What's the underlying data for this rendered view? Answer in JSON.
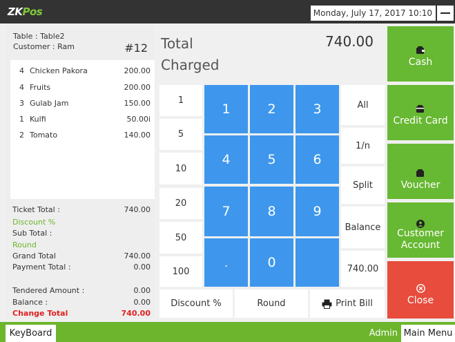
{
  "app": {
    "logo_main": "ZK",
    "logo_accent": "Pos",
    "datetime": "Monday, July 17, 2017 10:10"
  },
  "ticket": {
    "table": "Table : Table2",
    "customer": "Customer : Ram",
    "number": "#12",
    "items": [
      {
        "qty": "4",
        "name": "Chicken Pakora",
        "price": "200.00"
      },
      {
        "qty": "4",
        "name": "Fruits",
        "price": "200.00"
      },
      {
        "qty": "3",
        "name": "Gulab Jam",
        "price": "150.00"
      },
      {
        "qty": "1",
        "name": "Kulfi",
        "price": "50.00i"
      },
      {
        "qty": "2",
        "name": "Tomato",
        "price": "140.00"
      }
    ],
    "totals": {
      "ticket_total_label": "Ticket Total :",
      "ticket_total_value": "740.00",
      "discount_label": "Discount %",
      "sub_total_label": "Sub Total :",
      "round_label": "Round",
      "grand_total_label": "Grand Total",
      "grand_total_value": "740.00",
      "payment_total_label": "Payment Total :",
      "payment_total_value": "0.00",
      "tendered_label": "Tendered Amount :",
      "tendered_value": "0.00",
      "balance_label": "Balance :",
      "balance_value": "0.00",
      "change_label": "Change Total",
      "change_value": "740.00"
    }
  },
  "payment": {
    "total_title": "Total Charged",
    "total_amount": "740.00"
  },
  "keypad": {
    "quick_amounts": [
      "1",
      "5",
      "10",
      "20",
      "50",
      "100"
    ],
    "digits": [
      "1",
      "2",
      "3",
      "4",
      "5",
      "6",
      "7",
      "8",
      "9",
      ".",
      "0"
    ],
    "right_keys": [
      "All",
      "1/n",
      "Split",
      "Balance",
      "740.00"
    ],
    "bottom": {
      "discount": "Discount %",
      "round": "Round",
      "print_bill": "Print Bill"
    }
  },
  "actions": {
    "cash": "Cash",
    "credit_card": "Credit Card",
    "voucher": "Voucher",
    "customer_account_line1": "Customer",
    "customer_account_line2": "Account",
    "close": "Close"
  },
  "footer": {
    "keyboard": "KeyBoard",
    "user": "Admin",
    "main_menu": "Main Menu"
  },
  "colors": {
    "topbar": "#333333",
    "green": "#67b832",
    "blue": "#3e97ec",
    "red": "#e74c3c"
  }
}
